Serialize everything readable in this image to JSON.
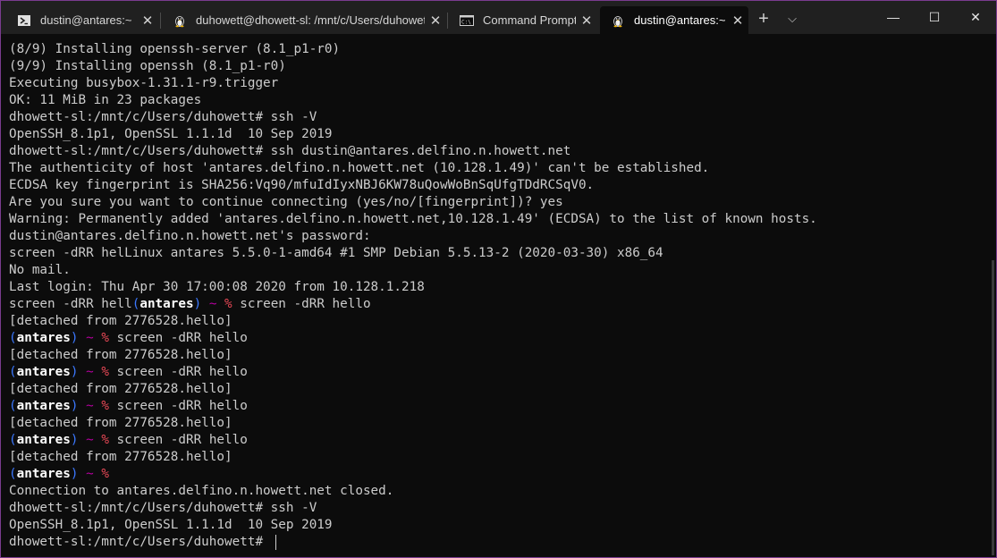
{
  "tabs": [
    {
      "title": "dustin@antares:~",
      "icon": "powershell-icon",
      "active": false
    },
    {
      "title": "duhowett@dhowett-sl: /mnt/c/Users/duhowett",
      "icon": "linux-tux-icon",
      "active": false
    },
    {
      "title": "Command Prompt",
      "icon": "cmd-icon",
      "active": false
    },
    {
      "title": "dustin@antares:~",
      "icon": "linux-tux-icon",
      "active": true
    }
  ],
  "titlebar": {
    "new_tab_symbol": "+",
    "dropdown_symbol": "⌵",
    "minimize_symbol": "—",
    "maximize_symbol": "☐",
    "close_symbol": "✕"
  },
  "colors": {
    "background": "#0c0c0c",
    "foreground": "#cccccc",
    "prompt_paren": "#3b78ff",
    "prompt_tilde": "#b4009e",
    "prompt_percent": "#e74856",
    "bold_white": "#ffffff",
    "window_border": "#7a3c8f"
  },
  "terminal": {
    "lines": [
      [
        {
          "t": "(8/9) Installing openssh-server (8.1_p1-r0)"
        }
      ],
      [
        {
          "t": "(9/9) Installing openssh (8.1_p1-r0)"
        }
      ],
      [
        {
          "t": "Executing busybox-1.31.1-r9.trigger"
        }
      ],
      [
        {
          "t": "OK: 11 MiB in 23 packages"
        }
      ],
      [
        {
          "t": "dhowett-sl:/mnt/c/Users/duhowett# ssh -V"
        }
      ],
      [
        {
          "t": "OpenSSH_8.1p1, OpenSSL 1.1.1d  10 Sep 2019"
        }
      ],
      [
        {
          "t": "dhowett-sl:/mnt/c/Users/duhowett# ssh dustin@antares.delfino.n.howett.net"
        }
      ],
      [
        {
          "t": "The authenticity of host 'antares.delfino.n.howett.net (10.128.1.49)' can't be established."
        }
      ],
      [
        {
          "t": "ECDSA key fingerprint is SHA256:Vq90/mfuIdIyxNBJ6KW78uQowWoBnSqUfgTDdRCSqV0."
        }
      ],
      [
        {
          "t": "Are you sure you want to continue connecting (yes/no/[fingerprint])? yes"
        }
      ],
      [
        {
          "t": "Warning: Permanently added 'antares.delfino.n.howett.net,10.128.1.49' (ECDSA) to the list of known hosts."
        }
      ],
      [
        {
          "t": "dustin@antares.delfino.n.howett.net's password:"
        }
      ],
      [
        {
          "t": "screen -dRR helLinux antares 5.5.0-1-amd64 #1 SMP Debian 5.5.13-2 (2020-03-30) x86_64"
        }
      ],
      [
        {
          "t": "No mail."
        }
      ],
      [
        {
          "t": "Last login: Thu Apr 30 17:00:08 2020 from 10.128.1.218"
        }
      ],
      [
        {
          "t": "screen -dRR hell"
        },
        {
          "t": "(",
          "c": "paren"
        },
        {
          "t": "antares",
          "c": "host"
        },
        {
          "t": ")",
          "c": "paren"
        },
        {
          "t": " "
        },
        {
          "t": "~",
          "c": "tilde"
        },
        {
          "t": " "
        },
        {
          "t": "%",
          "c": "pct"
        },
        {
          "t": " screen -dRR hello"
        }
      ],
      [
        {
          "t": "[detached from 2776528.hello]"
        }
      ],
      [
        {
          "t": "(",
          "c": "paren"
        },
        {
          "t": "antares",
          "c": "host"
        },
        {
          "t": ")",
          "c": "paren"
        },
        {
          "t": " "
        },
        {
          "t": "~",
          "c": "tilde"
        },
        {
          "t": " "
        },
        {
          "t": "%",
          "c": "pct"
        },
        {
          "t": " screen -dRR hello"
        }
      ],
      [
        {
          "t": "[detached from 2776528.hello]"
        }
      ],
      [
        {
          "t": "(",
          "c": "paren"
        },
        {
          "t": "antares",
          "c": "host"
        },
        {
          "t": ")",
          "c": "paren"
        },
        {
          "t": " "
        },
        {
          "t": "~",
          "c": "tilde"
        },
        {
          "t": " "
        },
        {
          "t": "%",
          "c": "pct"
        },
        {
          "t": " screen -dRR hello"
        }
      ],
      [
        {
          "t": "[detached from 2776528.hello]"
        }
      ],
      [
        {
          "t": "(",
          "c": "paren"
        },
        {
          "t": "antares",
          "c": "host"
        },
        {
          "t": ")",
          "c": "paren"
        },
        {
          "t": " "
        },
        {
          "t": "~",
          "c": "tilde"
        },
        {
          "t": " "
        },
        {
          "t": "%",
          "c": "pct"
        },
        {
          "t": " screen -dRR hello"
        }
      ],
      [
        {
          "t": "[detached from 2776528.hello]"
        }
      ],
      [
        {
          "t": "(",
          "c": "paren"
        },
        {
          "t": "antares",
          "c": "host"
        },
        {
          "t": ")",
          "c": "paren"
        },
        {
          "t": " "
        },
        {
          "t": "~",
          "c": "tilde"
        },
        {
          "t": " "
        },
        {
          "t": "%",
          "c": "pct"
        },
        {
          "t": " screen -dRR hello"
        }
      ],
      [
        {
          "t": "[detached from 2776528.hello]"
        }
      ],
      [
        {
          "t": "(",
          "c": "paren"
        },
        {
          "t": "antares",
          "c": "host"
        },
        {
          "t": ")",
          "c": "paren"
        },
        {
          "t": " "
        },
        {
          "t": "~",
          "c": "tilde"
        },
        {
          "t": " "
        },
        {
          "t": "%",
          "c": "pct"
        }
      ],
      [
        {
          "t": "Connection to antares.delfino.n.howett.net closed."
        }
      ],
      [
        {
          "t": "dhowett-sl:/mnt/c/Users/duhowett# ssh -V"
        }
      ],
      [
        {
          "t": "OpenSSH_8.1p1, OpenSSL 1.1.1d  10 Sep 2019"
        }
      ],
      [
        {
          "t": "dhowett-sl:/mnt/c/Users/duhowett# "
        }
      ]
    ]
  }
}
